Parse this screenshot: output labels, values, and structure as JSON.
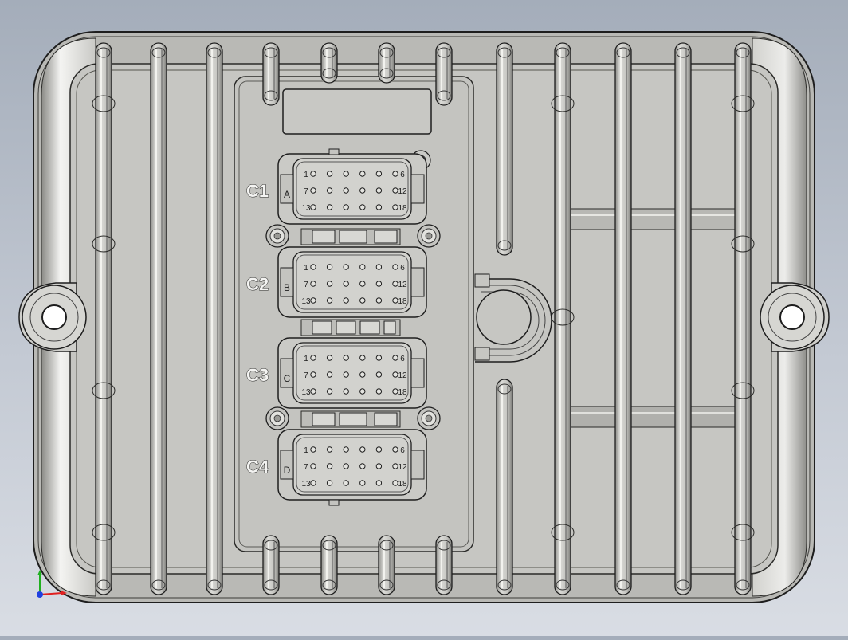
{
  "viewport": {
    "background": "CAD 3D viewport, grey gradient"
  },
  "part": {
    "name_visible": false,
    "body_color": "#c8c8c4",
    "edge_color": "#1e1e1e",
    "mount_tab_count": 2,
    "fin_count": 12
  },
  "connectors": [
    {
      "id": "C1",
      "label": "C1",
      "key": "A",
      "pins": [
        [
          "1",
          "6"
        ],
        [
          "7",
          "12"
        ],
        [
          "13",
          "18"
        ]
      ]
    },
    {
      "id": "C2",
      "label": "C2",
      "key": "B",
      "pins": [
        [
          "1",
          "6"
        ],
        [
          "7",
          "12"
        ],
        [
          "13",
          "18"
        ]
      ]
    },
    {
      "id": "C3",
      "label": "C3",
      "key": "C",
      "pins": [
        [
          "1",
          "6"
        ],
        [
          "7",
          "12"
        ],
        [
          "13",
          "18"
        ]
      ]
    },
    {
      "id": "C4",
      "label": "C4",
      "key": "D",
      "pins": [
        [
          "1",
          "6"
        ],
        [
          "7",
          "12"
        ],
        [
          "13",
          "18"
        ]
      ]
    }
  ],
  "triad": {
    "icon": "coordinate-triad-icon",
    "x_color": "#e02020",
    "y_color": "#20b020",
    "z_color": "#2040e0"
  }
}
